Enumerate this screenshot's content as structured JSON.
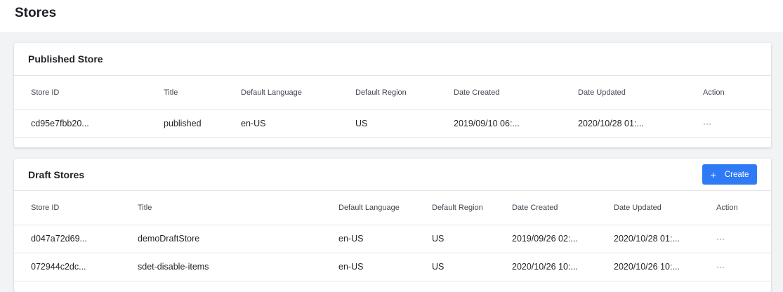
{
  "page": {
    "title": "Stores"
  },
  "published": {
    "title": "Published Store",
    "columns": [
      "Store ID",
      "Title",
      "Default Language",
      "Default Region",
      "Date Created",
      "Date Updated",
      "Action"
    ],
    "rows": [
      {
        "store_id": "cd95e7fbb20...",
        "title": "published",
        "language": "en-US",
        "region": "US",
        "created": "2019/09/10 06:...",
        "updated": "2020/10/28 01:...",
        "action": "···"
      }
    ]
  },
  "draft": {
    "title": "Draft Stores",
    "create_label": "Create",
    "create_icon": "plus-icon",
    "accent_color": "#2f7bf5",
    "columns": [
      "Store ID",
      "Title",
      "Default Language",
      "Default Region",
      "Date Created",
      "Date Updated",
      "Action"
    ],
    "rows": [
      {
        "store_id": "d047a72d69...",
        "title": "demoDraftStore",
        "language": "en-US",
        "region": "US",
        "created": "2019/09/26 02:...",
        "updated": "2020/10/28 01:...",
        "action": "···"
      },
      {
        "store_id": "072944c2dc...",
        "title": "sdet-disable-items",
        "language": "en-US",
        "region": "US",
        "created": "2020/10/26 10:...",
        "updated": "2020/10/26 10:...",
        "action": "···"
      }
    ]
  }
}
